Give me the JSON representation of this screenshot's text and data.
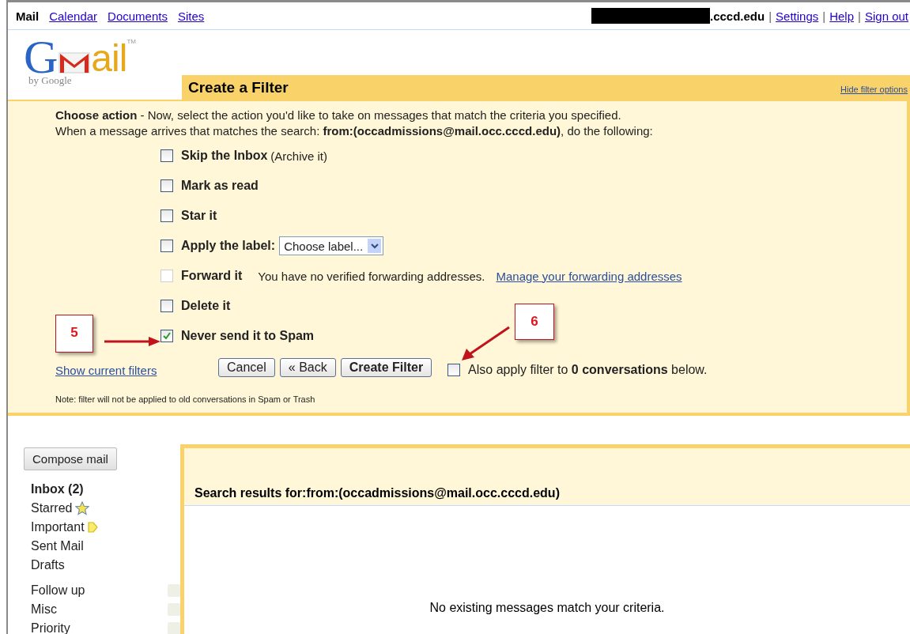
{
  "top_nav": {
    "items": [
      {
        "label": "Mail",
        "selected": true
      },
      {
        "label": "Calendar",
        "selected": false
      },
      {
        "label": "Documents",
        "selected": false
      },
      {
        "label": "Sites",
        "selected": false
      }
    ],
    "account": ".cccd.edu",
    "links": [
      "Settings",
      "Help",
      "Sign out"
    ],
    "separator": "|"
  },
  "logo": {
    "first": "G",
    "rest": "ail",
    "byline": "by Google",
    "tm": "TM"
  },
  "filter": {
    "title": "Create a Filter",
    "hide_link": "Hide filter options",
    "intro": "**Choose action** - Now, select the action you'd like to take on messages that match the criteria you specified.",
    "intro_2": "When a message arrives that matches the search: **from:(occadmissions@mail.occ.cccd.edu)**, do the following:",
    "actions": [
      {
        "kind": "plain",
        "label": "Skip the Inbox",
        "suffix": "(Archive it)",
        "checked": false,
        "disabled": false
      },
      {
        "kind": "plain",
        "label": "Mark as read",
        "checked": false,
        "disabled": false
      },
      {
        "kind": "plain",
        "label": "Star it",
        "checked": false,
        "disabled": false
      },
      {
        "kind": "label",
        "label": "Apply the label:",
        "dropdown": "Choose label...",
        "checked": false,
        "disabled": false
      },
      {
        "kind": "forward",
        "label": "Forward it",
        "note": "You have no verified forwarding addresses.",
        "link": "Manage your forwarding addresses",
        "checked": false,
        "disabled": true
      },
      {
        "kind": "plain",
        "label": "Delete it",
        "checked": false,
        "disabled": false
      },
      {
        "kind": "plain",
        "label": "Never send it to Spam",
        "checked": true,
        "disabled": false
      }
    ],
    "show_filters": "Show current filters",
    "buttons": [
      "Cancel",
      "« Back",
      "Create Filter"
    ],
    "also_apply": {
      "text": "Also apply filter to **0 conversations** below.",
      "checked": false
    },
    "note": "Note: filter will not be applied to old conversations in Spam or Trash"
  },
  "annotations": [
    "5",
    "6"
  ],
  "sidebar": {
    "compose": "Compose mail",
    "items": [
      {
        "kind": "bold",
        "label": "Inbox (2)"
      },
      {
        "kind": "star",
        "label": "Starred"
      },
      {
        "kind": "important",
        "label": "Important"
      },
      {
        "kind": "plain",
        "label": "Sent Mail"
      },
      {
        "kind": "plain",
        "label": "Drafts"
      }
    ],
    "labels": [
      "Follow up",
      "Misc",
      "Priority"
    ]
  },
  "results": {
    "heading": "Search results for:from:(occadmissions@mail.occ.cccd.edu)",
    "empty": "No existing messages match your criteria."
  }
}
